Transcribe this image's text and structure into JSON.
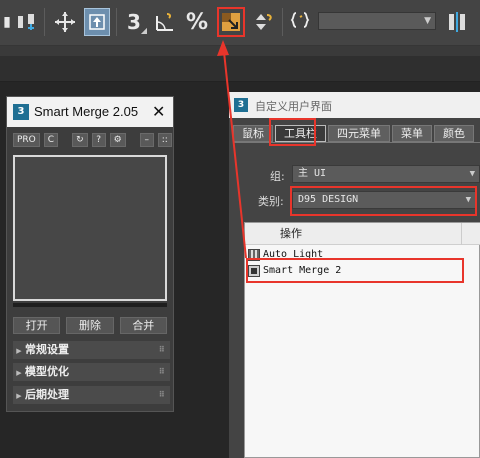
{
  "toolbar": {
    "icons": [
      "link-icon",
      "move-gizmo-icon",
      "select-object-icon",
      "snap-3d-icon",
      "angle-snap-icon",
      "percent-snap-icon",
      "smart-merge-icon",
      "spinner-snap-icon",
      "named-selection-icon",
      "mirror-icon"
    ],
    "snap_value": "3",
    "percent_glyph": "%",
    "named_selection_value": "",
    "highlight_color": "#e8352b"
  },
  "smart_merge": {
    "title": "Smart Merge 2.05",
    "close": "✕",
    "tools": [
      "PRO",
      "C",
      "↻",
      "?",
      "⚙",
      "–",
      "::"
    ],
    "buttons": [
      "打开",
      "删除",
      "合并"
    ],
    "rollouts": [
      {
        "label": "常规设置"
      },
      {
        "label": "模型优化"
      },
      {
        "label": "后期处理"
      }
    ]
  },
  "customize": {
    "title": "自定义用户界面",
    "tabs": [
      "鼠标",
      "工具栏",
      "四元菜单",
      "菜单",
      "颜色"
    ],
    "active_tab": "工具栏",
    "group_label": "组:",
    "group_value": "主 UI",
    "category_label": "类别:",
    "category_value": "D95 DESIGN",
    "list_header": "操作",
    "actions": [
      "Auto Light",
      "Smart Merge 2"
    ]
  }
}
